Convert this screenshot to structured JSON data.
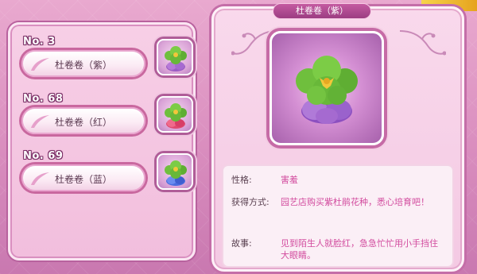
{
  "list": {
    "items": [
      {
        "number": "No. 3",
        "name": "杜卷卷（紫）",
        "variant": "purple"
      },
      {
        "number": "No. 68",
        "name": "杜卷卷（红）",
        "variant": "red"
      },
      {
        "number": "No. 69",
        "name": "杜卷卷（蓝）",
        "variant": "blue"
      }
    ]
  },
  "detail": {
    "title": "杜卷卷（紫）",
    "personality_label": "性格:",
    "personality_value": "害羞",
    "obtain_label": "获得方式:",
    "obtain_value": "园艺店购买紫杜鹃花种，悉心培育吧！",
    "story_label": "故事:",
    "story_value": "见到陌生人就脸红，急急忙忙用小手挡住大眼睛。"
  },
  "colors": {
    "accent": "#d24b9e",
    "panel_border": "#c46ea8",
    "background": "#e9a9cf"
  }
}
